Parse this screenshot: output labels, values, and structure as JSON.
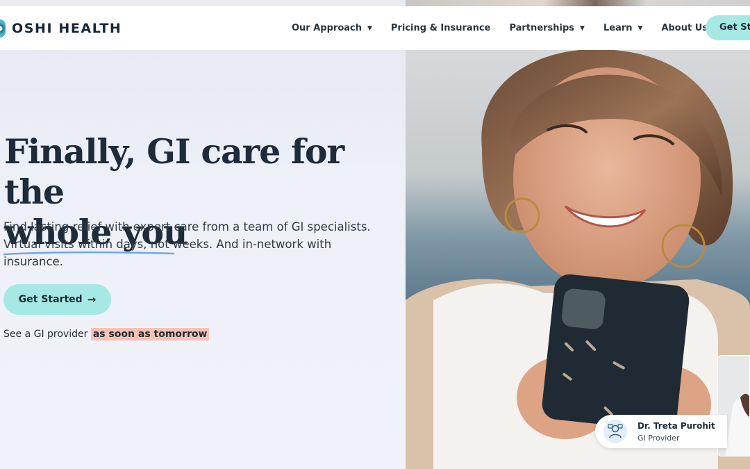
{
  "brand": {
    "name": "OSHI HEALTH"
  },
  "nav": {
    "items": [
      {
        "label": "Our Approach",
        "has_dropdown": true
      },
      {
        "label": "Pricing & Insurance",
        "has_dropdown": false
      },
      {
        "label": "Partnerships",
        "has_dropdown": true
      },
      {
        "label": "Learn",
        "has_dropdown": true
      },
      {
        "label": "About Us",
        "has_dropdown": true
      }
    ],
    "cta_label": "Get Started",
    "caret_glyph": "▼"
  },
  "hero": {
    "headline_line1": "Finally, GI care for the",
    "headline_line2": "whole you",
    "subtext": "Find lasting relief with expert care from a team of GI specialists. Virtual visits within days, not weeks. And in-network with insurance.",
    "cta_label": "Get Started",
    "cta_arrow": "→",
    "availability_prefix": "See a GI provider",
    "availability_highlight": "as soon as tomorrow"
  },
  "provider_badge": {
    "name": "Dr. Treta Purohit",
    "role": "GI Provider",
    "icon": "doctor-icon"
  },
  "colors": {
    "accent": "#a6e8e3",
    "highlight": "#f6c2b3",
    "heading": "#1d2b3a",
    "underline": "#6fa8e0"
  }
}
